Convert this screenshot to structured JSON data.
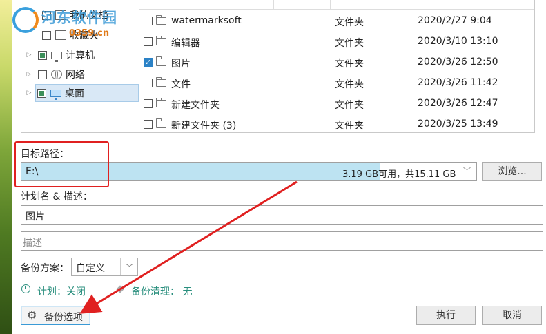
{
  "tree": {
    "items": [
      {
        "label": "我的文档",
        "icon": "document-icon",
        "state": "unchecked"
      },
      {
        "label": "收藏夹",
        "icon": "document-icon",
        "state": "unchecked"
      },
      {
        "label": "计算机",
        "icon": "computer-icon",
        "state": "partial"
      },
      {
        "label": "网络",
        "icon": "network-icon",
        "state": "unchecked"
      },
      {
        "label": "桌面",
        "icon": "desktop-icon",
        "state": "partial",
        "selected": true
      }
    ]
  },
  "files": [
    {
      "name": "watermarksoft",
      "type": "文件夹",
      "date": "2020/2/27 9:04",
      "checked": false
    },
    {
      "name": "编辑器",
      "type": "文件夹",
      "date": "2020/3/10 13:10",
      "checked": false
    },
    {
      "name": "图片",
      "type": "文件夹",
      "date": "2020/3/26 12:50",
      "checked": true
    },
    {
      "name": "文件",
      "type": "文件夹",
      "date": "2020/3/26 11:42",
      "checked": false
    },
    {
      "name": "新建文件夹",
      "type": "文件夹",
      "date": "2020/3/26 12:47",
      "checked": false
    },
    {
      "name": "新建文件夹 (3)",
      "type": "文件夹",
      "date": "2020/3/25 13:49",
      "checked": false
    }
  ],
  "target": {
    "label": "目标路径：",
    "path": "E:\\",
    "space_text": "3.19 GB可用，共15.11 GB",
    "used_fraction": 0.789,
    "browse_label": "浏览..."
  },
  "plan": {
    "label": "计划名 & 描述：",
    "name_value": "图片",
    "desc_placeholder": "描述"
  },
  "scheme": {
    "label": "备份方案：",
    "selected": "自定义"
  },
  "status": {
    "schedule": "计划：关闭",
    "cleanup": "备份清理：  无"
  },
  "buttons": {
    "options": "备份选项",
    "execute": "执行",
    "cancel": "取消"
  },
  "watermark": {
    "text": "河东软件园",
    "url": "0359.cn"
  },
  "colors": {
    "accent": "#3a9ad6",
    "status_text": "#2a8f7e",
    "annotation_red": "#e02020"
  }
}
